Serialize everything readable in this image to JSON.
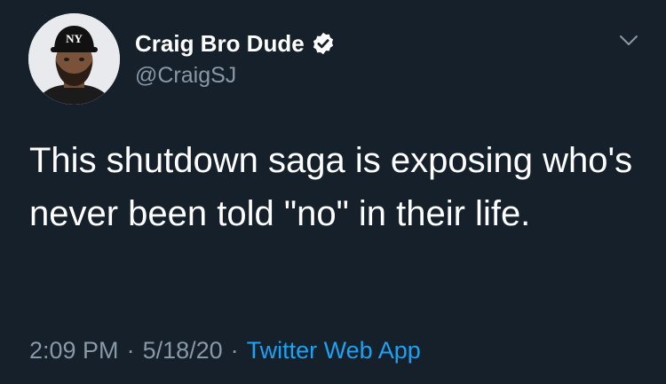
{
  "tweet": {
    "author": {
      "display_name": "Craig Bro Dude",
      "handle": "@CraigSJ",
      "verified": true,
      "avatar_icon": "profile-photo"
    },
    "text": "This shutdown saga is exposing who's never been told \"no\" in their life.",
    "time": "2:09 PM",
    "date": "5/18/20",
    "separator": "·",
    "source": "Twitter Web App"
  },
  "colors": {
    "background": "#15202b",
    "text_primary": "#ffffff",
    "text_secondary": "#8899a6",
    "accent": "#1da1f2"
  }
}
